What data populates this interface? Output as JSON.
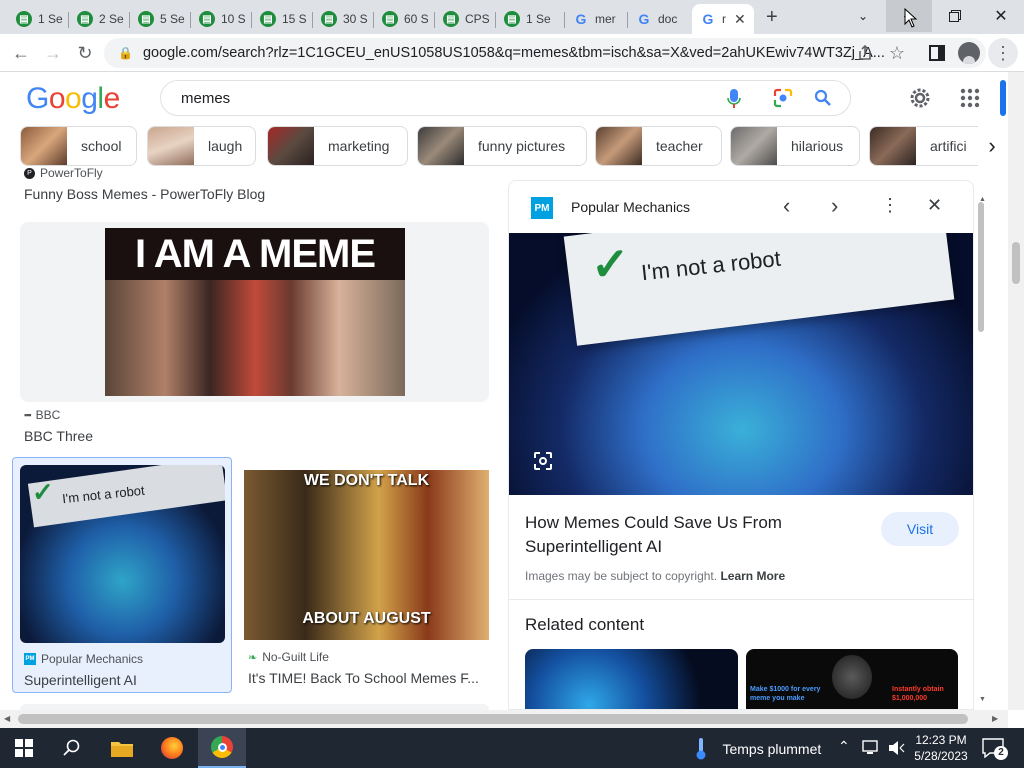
{
  "tabs": [
    {
      "label": "1 Se",
      "favicon": "sheets-icon"
    },
    {
      "label": "2 Se",
      "favicon": "sheets-icon"
    },
    {
      "label": "5 Se",
      "favicon": "sheets-icon"
    },
    {
      "label": "10 S",
      "favicon": "sheets-icon"
    },
    {
      "label": "15 S",
      "favicon": "sheets-icon"
    },
    {
      "label": "30 S",
      "favicon": "sheets-icon"
    },
    {
      "label": "60 S",
      "favicon": "sheets-icon"
    },
    {
      "label": "CPS",
      "favicon": "sheets-icon"
    },
    {
      "label": "1 Se",
      "favicon": "sheets-icon"
    },
    {
      "label": "mer",
      "favicon": "google-icon"
    },
    {
      "label": "doc",
      "favicon": "google-icon"
    },
    {
      "label": "r",
      "favicon": "google-icon"
    }
  ],
  "address": {
    "url": "google.com/search?rlz=1C1GCEU_enUS1058US1058&q=memes&tbm=isch&sa=X&ved=2ahUKEwiv74WT3Zj_A..."
  },
  "google": {
    "logo": "Google",
    "query": "memes"
  },
  "chips": [
    "school",
    "laugh",
    "marketing",
    "funny pictures",
    "teacher",
    "hilarious",
    "artifici"
  ],
  "results": {
    "r1": {
      "source": "PowerToFly",
      "title": "Funny Boss Memes - PowerToFly Blog"
    },
    "r2": {
      "image_caption": "I AM A MEME",
      "source": "BBC",
      "title": "BBC Three"
    },
    "r3": {
      "image_caption": "I'm not a robot",
      "source": "Popular Mechanics",
      "title": "Superintelligent AI"
    },
    "r4": {
      "caption_top": "WE DON'T TALK",
      "caption_bottom": "ABOUT AUGUST",
      "source": "No-Guilt Life",
      "title": "It's TIME! Back To School Memes F..."
    }
  },
  "panel": {
    "source": "Popular Mechanics",
    "source_badge": "PM",
    "image_caption": "I'm not a robot",
    "title": "How Memes Could Save Us From Superintelligent AI",
    "visit": "Visit",
    "copyright": "Images may be subject to copyright.",
    "learn_more": "Learn More",
    "related_heading": "Related content",
    "related": [
      {
        "caption": ""
      },
      {
        "caption_left": "Make $1000 for every meme you make",
        "caption_right": "Instantly obtain $1,000,000"
      }
    ]
  },
  "taskbar": {
    "weather": "Temps plummet",
    "time": "12:23 PM",
    "date": "5/28/2023",
    "notifications": "2"
  },
  "colors": {
    "google_blue": "#4285f4",
    "google_red": "#ea4335",
    "google_yellow": "#fbbc05",
    "google_green": "#34a853",
    "taskbar": "#1f2733",
    "tabstrip": "#dee1e6"
  }
}
